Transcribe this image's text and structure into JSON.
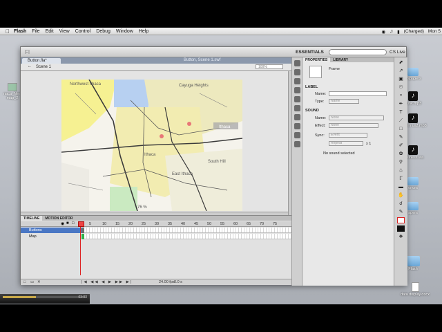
{
  "menubar": {
    "apple": "",
    "items": [
      "Flash",
      "File",
      "Edit",
      "View",
      "Control",
      "Debug",
      "Window",
      "Help"
    ],
    "status": "(Charged)",
    "clock": "Mon 5"
  },
  "desktop_icons": [
    {
      "label": "wspapers",
      "type": "folder"
    },
    {
      "label": "_unk.mp3",
      "type": "note"
    },
    {
      "label": "andem ux2.mp3",
      "type": "note"
    },
    {
      "label": "business.wa",
      "type": "note"
    },
    {
      "label": "onors",
      "type": "folder"
    },
    {
      "label": "apers",
      "type": "folder"
    },
    {
      "label": "Flash",
      "type": "folder"
    },
    {
      "label": "data display.docx",
      "type": "doc"
    },
    {
      "label": "naca_New map_2",
      "type": "doc"
    }
  ],
  "flash": {
    "workspace": "ESSENTIALS",
    "search_placeholder": "",
    "cs_live": "CS Live",
    "doc_tab": "Button.fla*",
    "doc_title": "Button, Scene 1.swf",
    "scene": "Scene 1",
    "zoom": "100%",
    "map_labels": [
      "Northwest Ithaca",
      "Cayuga Heights",
      "Ithaca",
      "East Ithaca",
      "South Hill",
      "Ithaca",
      "76 %"
    ]
  },
  "timeline": {
    "tabs": [
      "TIMELINE",
      "MOTION EDITOR"
    ],
    "frame_numbers": [
      "5",
      "10",
      "15",
      "20",
      "25",
      "30",
      "35",
      "40",
      "45",
      "50",
      "55",
      "60",
      "65",
      "70",
      "75"
    ],
    "layers": [
      {
        "name": "Buttons",
        "selected": true
      },
      {
        "name": "Map",
        "selected": false
      }
    ],
    "controls": "|◀ ◀◀ ◀ ▶ ▶▶ ▶|",
    "fps": "24.00 fps",
    "time": "0.0 s"
  },
  "properties": {
    "tabs": [
      "PROPERTIES",
      "LIBRARY"
    ],
    "object_type": "Frame",
    "label_section": "LABEL",
    "name_label": "Name:",
    "type_label": "Type:",
    "type_value": "Name",
    "sound_section": "SOUND",
    "sound_name_value": "None",
    "effect_label": "Effect:",
    "effect_value": "None",
    "sync_label": "Sync:",
    "sync_value": "Event",
    "repeat_value": "Repeat",
    "repeat_count": "x 1",
    "no_sound": "No sound selected"
  },
  "video": {
    "time": "03:03",
    "progress": 0.4
  },
  "colors": {
    "selection": "#4a77c4",
    "playhead": "#dd2222"
  }
}
